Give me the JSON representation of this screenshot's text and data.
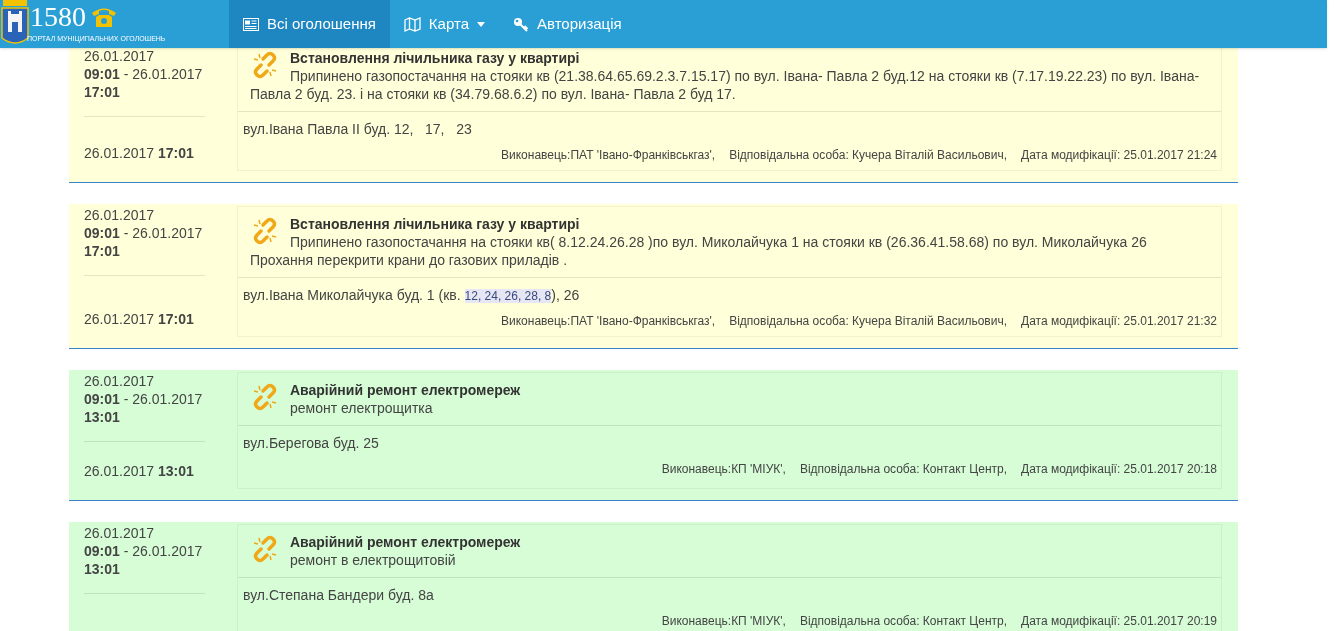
{
  "navbar": {
    "logo_number": "1580",
    "logo_caption": "ПОРТАЛ МУНІЦИПАЛЬНИХ ОГОЛОШЕНЬ",
    "items": [
      {
        "kind": "list",
        "label": "Всі оголошення",
        "selected": true
      },
      {
        "kind": "dropdown",
        "label": "Карта",
        "selected": false
      },
      {
        "kind": "key",
        "label": "Авторизація",
        "selected": false
      }
    ]
  },
  "announcements": [
    {
      "color": "#ffffd9",
      "period_lines": [
        "26.01.2017",
        "**09:01** - 26.01.2017",
        "**17:01**"
      ],
      "published": "26.01.2017 **17:01**",
      "title": "Встановлення лічильника газу у квартирі",
      "description": "Припинено газопостачання на стояки кв (21.38.64.65.69.2.3.7.15.17) по вул. Івана- Павла 2 буд.12 на стояки кв (7.17.19.22.23) по вул. Івана-Павла 2 буд. 23. і на стояки кв (34.79.68.6.2) по вул. Івана- Павла 2 буд 17.",
      "address": [
        {
          "text": "вул.Івана Павла ІІ буд. 12,   17,   23",
          "highlighted": false
        }
      ],
      "contractor": "Виконавець:ПАТ 'Івано-Франківськгаз',",
      "responsible": "Відповідальна особа: Кучера Віталій Васильович,",
      "modified": "Дата модифікації: 25.01.2017 21:24"
    },
    {
      "color": "#ffffd9",
      "period_lines": [
        "26.01.2017",
        "**09:01** - 26.01.2017",
        "**17:01**"
      ],
      "published": "26.01.2017 **17:01**",
      "title": "Встановлення лічильника газу у квартирі",
      "description": "Припинено газопостачання на стояки кв( 8.12.24.26.28 )по вул. Миколайчука 1 на стояки кв (26.36.41.58.68) по вул. Миколайчука 26 Прохання перекрити крани до газових приладів .",
      "address": [
        {
          "text": "вул.Івана Миколайчука буд. 1 (кв. ",
          "highlighted": false
        },
        {
          "text": "12, 24, 26, 28, 8",
          "highlighted": true
        },
        {
          "text": "), 26",
          "highlighted": false
        }
      ],
      "contractor": "Виконавець:ПАТ 'Івано-Франківськгаз',",
      "responsible": "Відповідальна особа: Кучера Віталій Васильович,",
      "modified": "Дата модифікації: 25.01.2017 21:32"
    },
    {
      "color": "#d6fdd6",
      "period_lines": [
        "26.01.2017",
        "**09:01** - 26.01.2017",
        "**13:01**"
      ],
      "published": "26.01.2017 **13:01**",
      "title": "Аварійний ремонт електромереж",
      "description": "ремонт електрощитка",
      "address": [
        {
          "text": "вул.Берегова буд. 25",
          "highlighted": false
        }
      ],
      "contractor": "Виконавець:КП 'МІУК',",
      "responsible": "Відповідальна особа: Контакт Центр,",
      "modified": "Дата модифікації: 25.01.2017 20:18"
    },
    {
      "color": "#d6fdd6",
      "period_lines": [
        "26.01.2017",
        "**09:01** - 26.01.2017",
        "**13:01**"
      ],
      "title": "Аварійний ремонт електромереж",
      "description": "ремонт в електрощитовій",
      "address": [
        {
          "text": "вул.Степана Бандери буд. 8а",
          "highlighted": false
        }
      ],
      "contractor": "Виконавець:КП 'МІУК',",
      "responsible": "Відповідальна особа: Контакт Центр,",
      "modified": "Дата модифікації: 25.01.2017 20:19"
    }
  ]
}
